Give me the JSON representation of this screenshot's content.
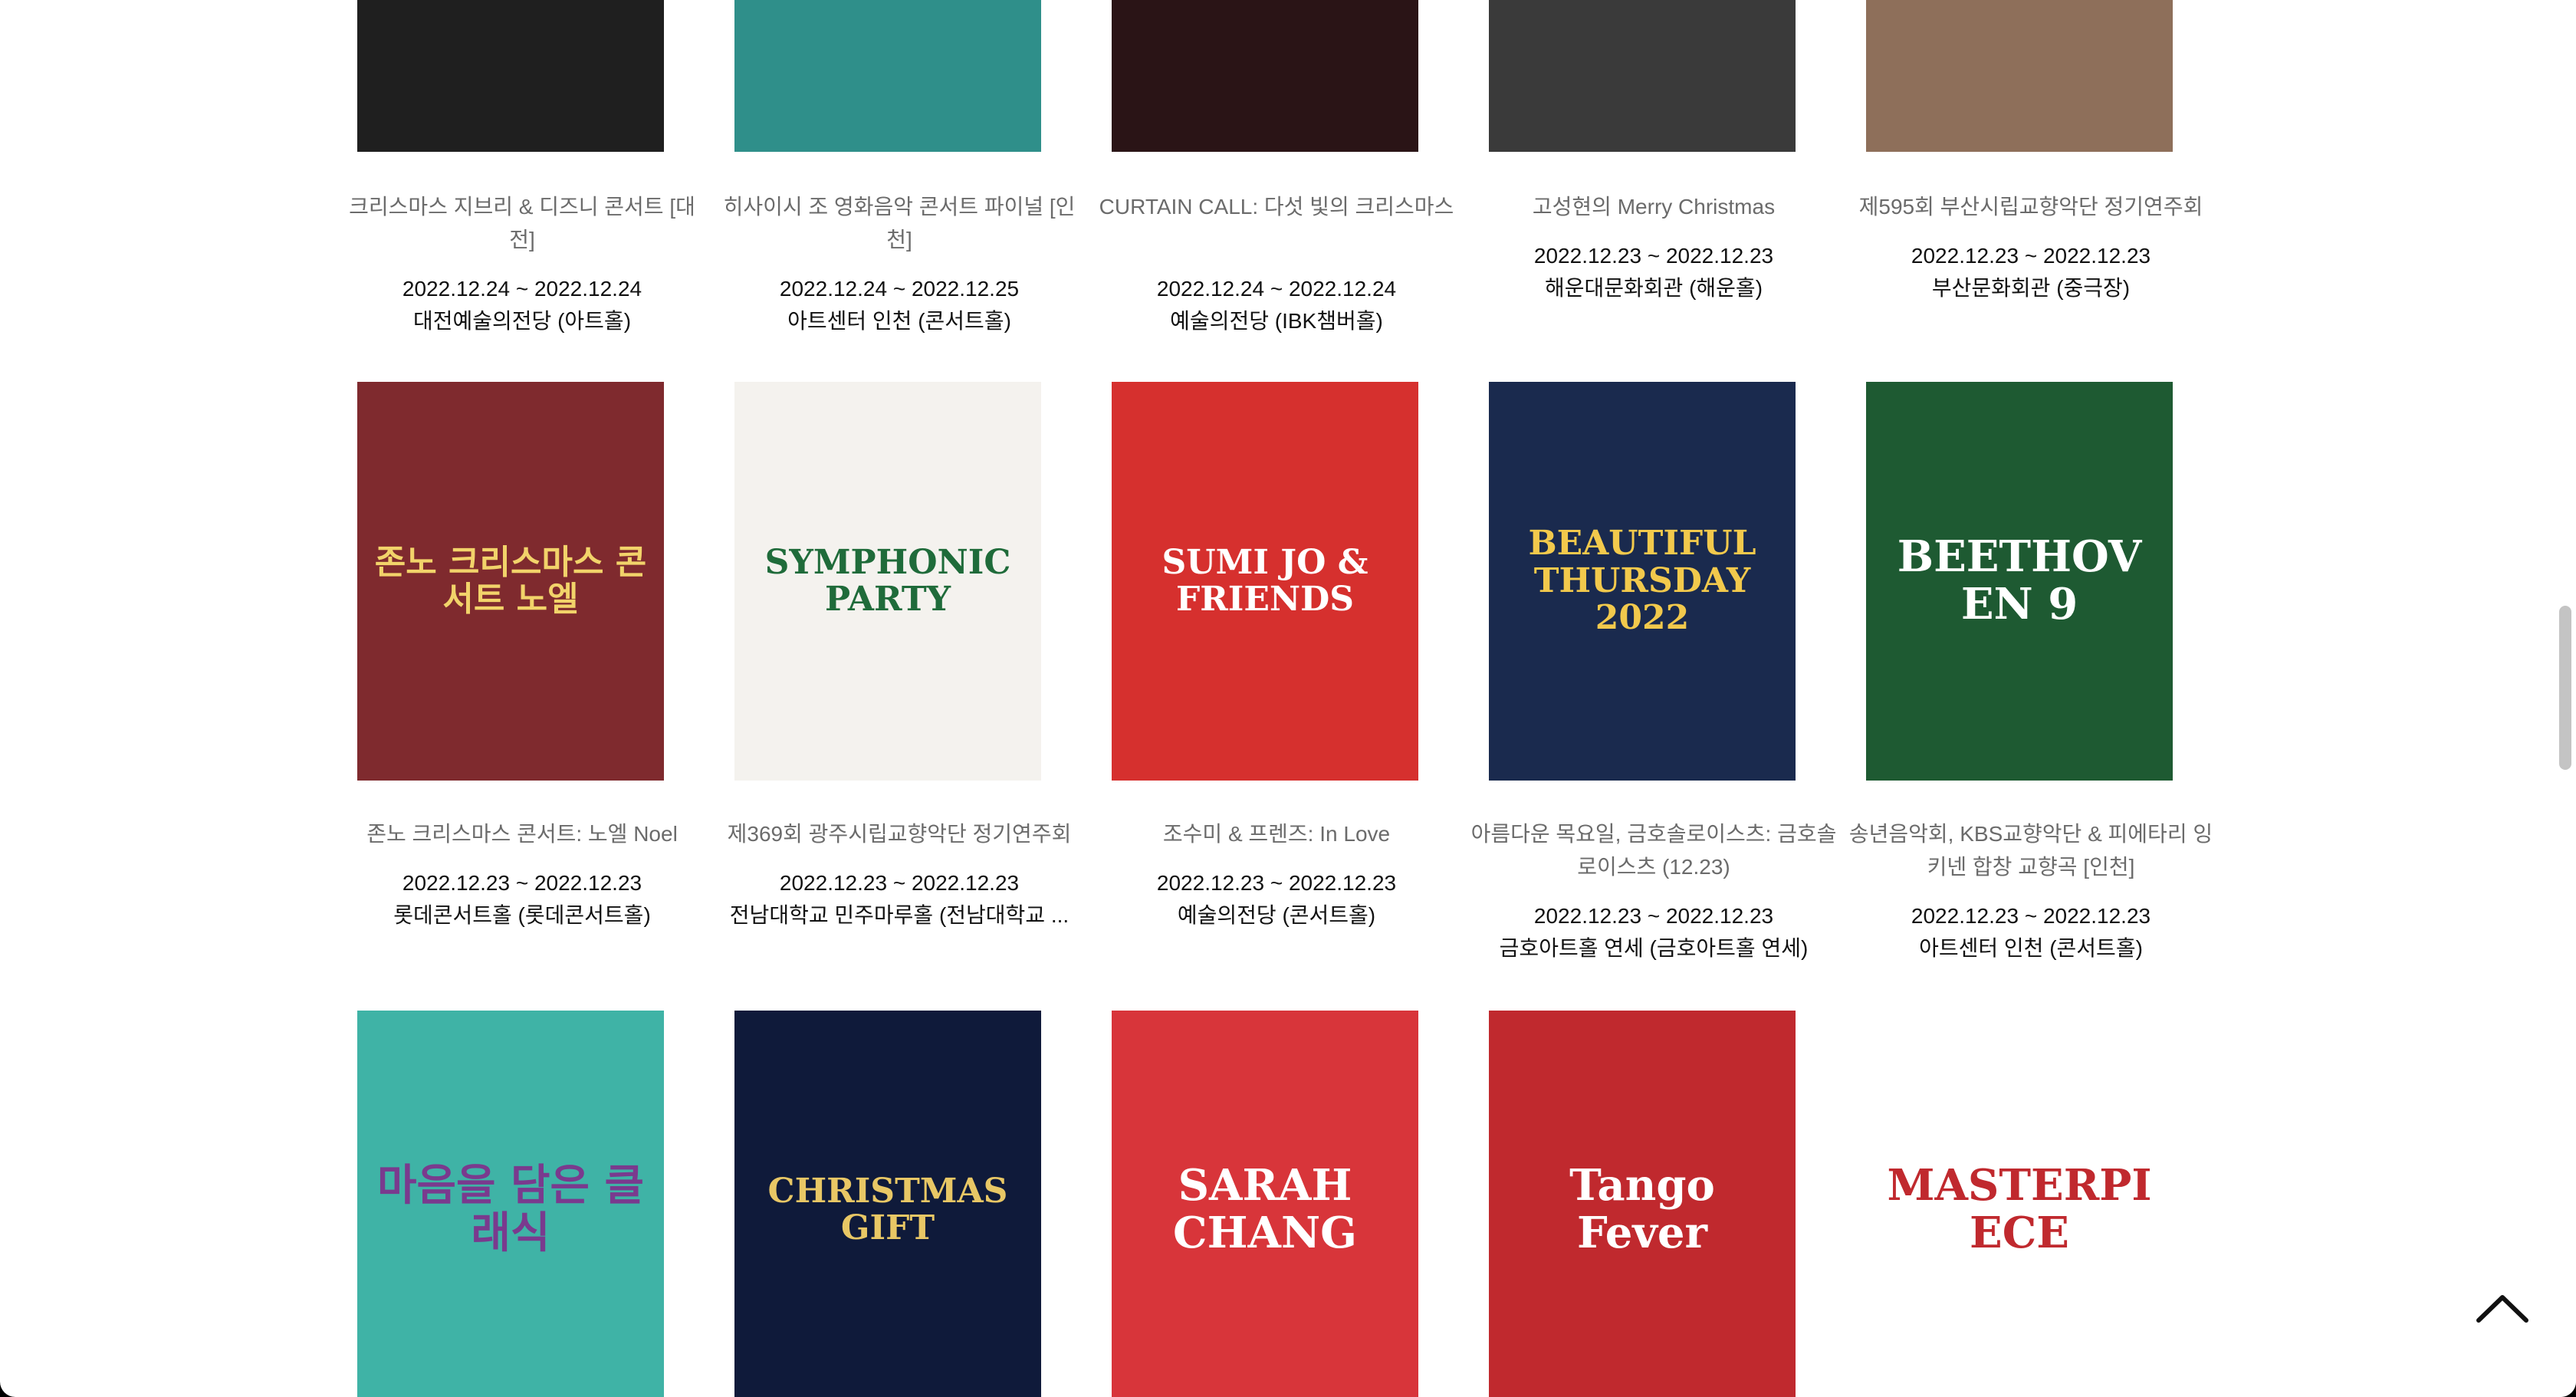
{
  "rows": [
    [
      {
        "title": "크리스마스 지브리 & 디즈니 콘서트 [대전]",
        "date": "2022.12.24 ~ 2022.12.24",
        "venue": "대전예술의전당 (아트홀)",
        "poster_bg": "#1f1f1f",
        "poster_fg": "#d8b24a",
        "poster_text": ""
      },
      {
        "title": "히사이시 조 영화음악 콘서트 파이널 [인천]",
        "date": "2022.12.24 ~ 2022.12.25",
        "venue": "아트센터 인천 (콘서트홀)",
        "poster_bg": "#2f8f8a",
        "poster_fg": "#ffffff",
        "poster_text": ""
      },
      {
        "title": "CURTAIN CALL: 다섯 빛의 크리스마스",
        "date": "2022.12.24 ~ 2022.12.24",
        "venue": "예술의전당 (IBK챔버홀)",
        "poster_bg": "#2a1416",
        "poster_fg": "#ffffff",
        "poster_text": ""
      },
      {
        "title": "고성현의 Merry Christmas",
        "date": "2022.12.23 ~ 2022.12.23",
        "venue": "해운대문화회관 (해운홀)",
        "poster_bg": "#3a3a3a",
        "poster_fg": "#ffffff",
        "poster_text": ""
      },
      {
        "title": "제595회 부산시립교향악단 정기연주회",
        "date": "2022.12.23 ~ 2022.12.23",
        "venue": "부산문화회관 (중극장)",
        "poster_bg": "#8e6f5a",
        "poster_fg": "#ffffff",
        "poster_text": ""
      }
    ],
    [
      {
        "title": "존노 크리스마스 콘서트: 노엘 Noel",
        "date": "2022.12.23 ~ 2022.12.23",
        "venue": "롯데콘서트홀 (롯데콘서트홀)",
        "poster_bg": "#7f2a2e",
        "poster_fg": "#f2d36a",
        "poster_text": "존노 크리스마스 콘서트 노엘"
      },
      {
        "title": "제369회 광주시립교향악단 정기연주회",
        "date": "2022.12.23 ~ 2022.12.23",
        "venue": "전남대학교 민주마루홀 (전남대학교 ...",
        "poster_bg": "#f4f2ee",
        "poster_fg": "#1f6b3a",
        "poster_text": "SYMPHONIC PARTY"
      },
      {
        "title": "조수미 & 프렌즈: In Love",
        "date": "2022.12.23 ~ 2022.12.23",
        "venue": "예술의전당 (콘서트홀)",
        "poster_bg": "#d6302e",
        "poster_fg": "#ffffff",
        "poster_text": "SUMI JO & FRIENDS"
      },
      {
        "title": "아름다운 목요일, 금호솔로이스츠: 금호솔로이스츠 (12.23)",
        "date": "2022.12.23 ~ 2022.12.23",
        "venue": "금호아트홀 연세 (금호아트홀 연세)",
        "poster_bg": "#1a2a4e",
        "poster_fg": "#f2c94c",
        "poster_text": "BEAUTIFUL THURSDAY 2022"
      },
      {
        "title": "송년음악회, KBS교향악단 & 피에타리 잉키넨 합창 교향곡 [인천]",
        "date": "2022.12.23 ~ 2022.12.23",
        "venue": "아트센터 인천 (콘서트홀)",
        "poster_bg": "#1e5a32",
        "poster_fg": "#ffffff",
        "poster_text": "BEETHOVEN 9"
      }
    ],
    [
      {
        "title": "",
        "date": "",
        "venue": "",
        "poster_bg": "#3fb3a6",
        "poster_fg": "#7a3a8e",
        "poster_text": "마음을 담은 클래식"
      },
      {
        "title": "",
        "date": "",
        "venue": "",
        "poster_bg": "#0f1a3a",
        "poster_fg": "#e8c765",
        "poster_text": "CHRISTMAS GIFT"
      },
      {
        "title": "",
        "date": "",
        "venue": "",
        "poster_bg": "#d8353a",
        "poster_fg": "#ffffff",
        "poster_text": "SARAH CHANG"
      },
      {
        "title": "",
        "date": "",
        "venue": "",
        "poster_bg": "#c0292e",
        "poster_fg": "#ffffff",
        "poster_text": "Tango Fever"
      },
      {
        "title": "",
        "date": "",
        "venue": "",
        "poster_bg": "#ffffff",
        "poster_fg": "#c0292e",
        "poster_text": "MASTERPIECE"
      }
    ]
  ],
  "back_to_top_icon": "chevron-up-icon",
  "colors": {
    "title": "#6b6b6b",
    "meta": "#111111",
    "background": "#ffffff"
  }
}
